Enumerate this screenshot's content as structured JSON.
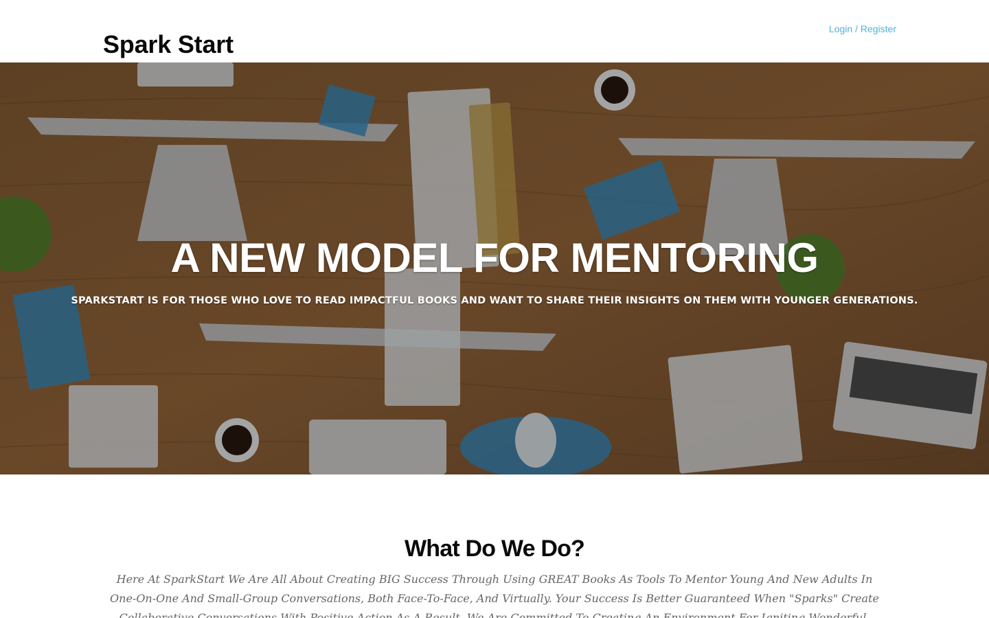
{
  "header": {
    "brand": "Spark Start",
    "login_register": "Login / Register"
  },
  "hero": {
    "title": "A NEW MODEL FOR MENTORING",
    "subtitle": "SPARKSTART IS FOR THOSE WHO LOVE TO READ IMPACTFUL BOOKS AND WANT TO SHARE THEIR INSIGHTS ON THEM WITH YOUNGER GENERATIONS."
  },
  "about": {
    "title": "What Do We Do?",
    "body": "Here At SparkStart We Are All About Creating BIG Success Through Using GREAT Books As Tools To Mentor Young And New Adults In One-On-One And Small-Group Conversations, Both Face-To-Face, And Virtually. Your Success Is Better Guaranteed When \"Sparks\" Create Collaborative Conversations With Positive Action As A Result. We Are Committed To Creating An Environment For Igniting Wonderful, Make-A-Difference Conversations And Results That"
  },
  "colors": {
    "link": "#4fb3d9",
    "hero_wood": "#6b4a2b",
    "body_text": "#666666"
  }
}
